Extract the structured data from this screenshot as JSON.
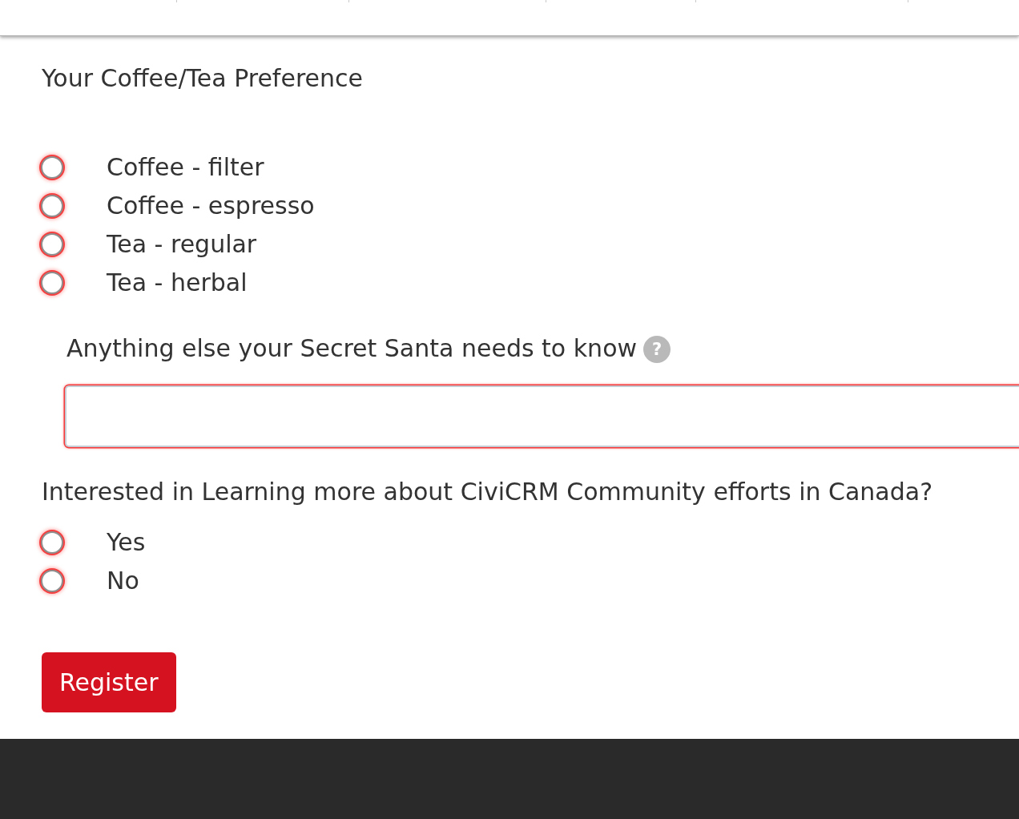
{
  "sections": [
    {
      "kind": "radio_group",
      "label": "Your Coffee/Tea Preference",
      "options": [
        {
          "label": "Coffee - filter",
          "selected": false
        },
        {
          "label": "Coffee - espresso",
          "selected": false
        },
        {
          "label": "Tea - regular",
          "selected": false
        },
        {
          "label": "Tea - herbal",
          "selected": false
        }
      ]
    },
    {
      "kind": "text_field",
      "label": "Anything else your Secret Santa needs to know",
      "help_icon": "?"
    },
    {
      "kind": "radio_group",
      "label": "Interested in Learning more about CiviCRM Community efforts in Canada?",
      "options": [
        {
          "label": "Yes",
          "selected": false
        },
        {
          "label": "No",
          "selected": false
        }
      ]
    }
  ],
  "submit_button": {
    "label": "Register"
  }
}
